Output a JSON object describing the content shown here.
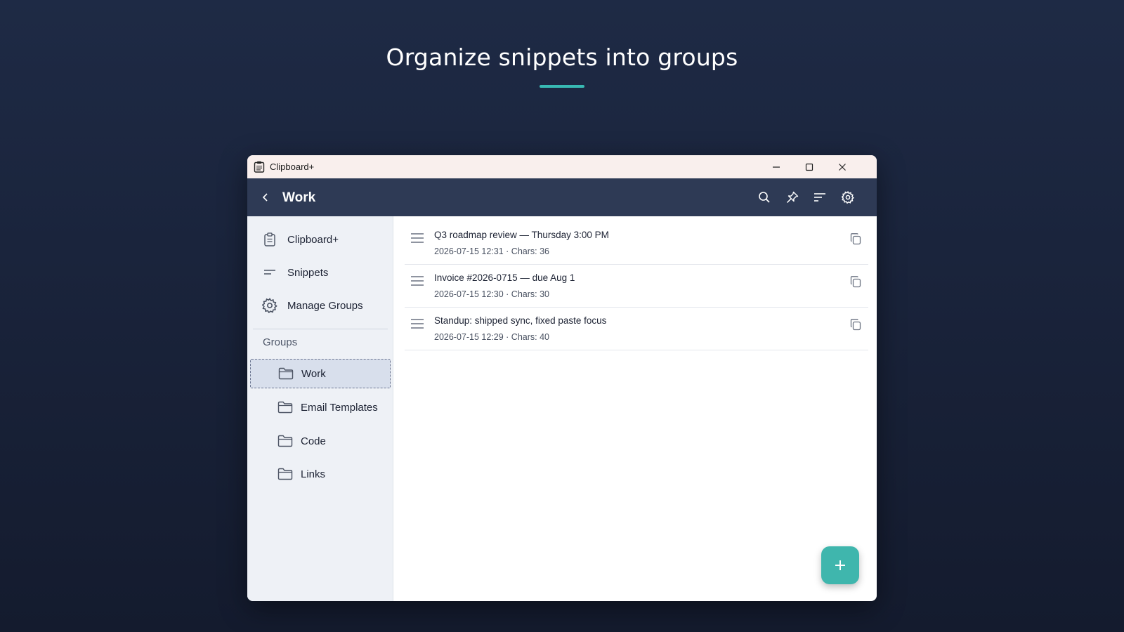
{
  "hero": {
    "title": "Organize snippets into groups"
  },
  "window": {
    "title": "Clipboard+"
  },
  "appbar": {
    "title": "Work"
  },
  "sidebar": {
    "nav": [
      {
        "label": "Clipboard+",
        "icon": "clipboard-icon"
      },
      {
        "label": "Snippets",
        "icon": "snippets-icon"
      },
      {
        "label": "Manage Groups",
        "icon": "gear-icon"
      }
    ],
    "groups_header": "Groups",
    "groups": [
      {
        "label": "Work",
        "selected": true
      },
      {
        "label": "Email Templates",
        "selected": false
      },
      {
        "label": "Code",
        "selected": false
      },
      {
        "label": "Links",
        "selected": false
      }
    ]
  },
  "snippets": [
    {
      "text": "Q3 roadmap review — Thursday 3:00 PM",
      "meta": "2026-07-15 12:31 · Chars: 36"
    },
    {
      "text": "Invoice #2026-0715 — due Aug 1",
      "meta": "2026-07-15 12:30 · Chars: 30"
    },
    {
      "text": "Standup: shipped sync, fixed paste focus",
      "meta": "2026-07-15 12:29 · Chars: 40"
    }
  ],
  "colors": {
    "accent": "#3fb6ad",
    "appbar": "#2e3a55",
    "underline": "#38b9b3"
  }
}
